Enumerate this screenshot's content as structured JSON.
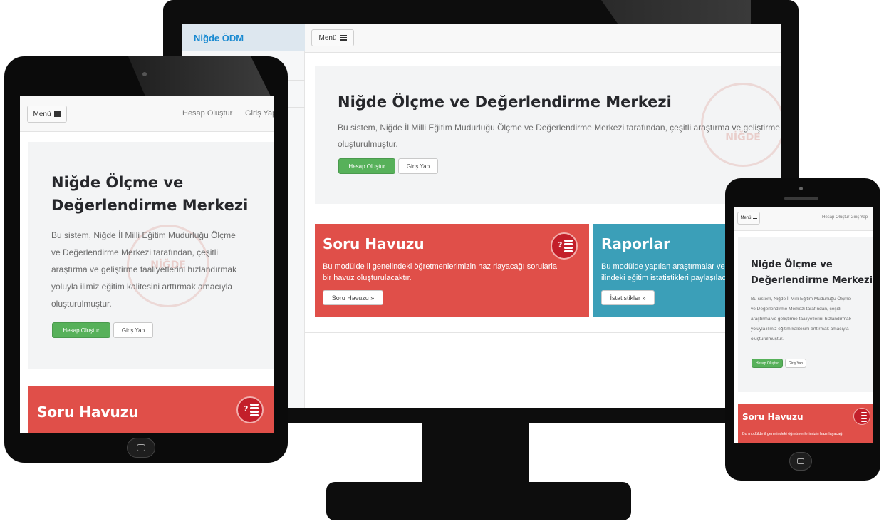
{
  "colors": {
    "brand_blue": "#1a8ad1",
    "green": "#57b15a",
    "red": "#e04f49",
    "teal": "#3b9fb8",
    "icon_red": "#c31f2a",
    "bezel": "#0d0d0d"
  },
  "desktop": {
    "brand": "Niğde ÖDM",
    "menu_label": "Menü",
    "title": "Niğde Ölçme ve Değerlendirme Merkezi",
    "lead_line1": "Bu sistem, Niğde İl Milli Eğitim Mudurluğu Ölçme ve Değerlendirme Merkezi tarafından, çeşitli araştırma ve geliştirme faaliyetlerini",
    "lead_line2": "oluşturulmuştur.",
    "btn_create": "Hesap Oluştur",
    "btn_login": "Giriş Yap",
    "seal_text": "NİĞDE",
    "card1": {
      "title": "Soru Havuzu",
      "text_line1": "Bu modülde il genelindeki öğretmenlerimizin hazırlayacağı sorularla",
      "text_line2": "bir havuz oluşturulacaktır.",
      "button": "Soru Havuzu »"
    },
    "card2": {
      "title": "Raporlar",
      "text_line1": "Bu modülde yapılan araştırmalar ve",
      "text_line2": "ilindeki eğitim istatistikleri paylaşılacaktır.",
      "button": "İstatistikler »"
    }
  },
  "tablet": {
    "menu_label": "Menü",
    "nav_create": "Hesap Oluştur",
    "nav_login": "Giriş Yap",
    "title_line1": "Niğde Ölçme ve",
    "title_line2": "Değerlendirme Merkezi",
    "lead_lines": [
      "Bu sistem, Niğde İl Milli Eğitim Mudurluğu Ölçme",
      "ve Değerlendirme Merkezi tarafından, çeşitli",
      "araştırma ve geliştirme faaliyetlerini hızlandırmak",
      "yoluyla ilimiz eğitim kalitesini arttırmak amacıyla",
      "oluşturulmuştur."
    ],
    "btn_create": "Hesap Oluştur",
    "btn_login": "Giriş Yap",
    "seal_text": "NİĞDE",
    "card_title": "Soru Havuzu"
  },
  "phone": {
    "menu_label": "Menü",
    "nav_create": "Hesap Oluştur",
    "nav_login": "Giriş Yap",
    "title_line1": "Niğde Ölçme ve",
    "title_line2": "Değerlendirme Merkezi",
    "lead_lines": [
      "Bu sistem, Niğde İl Milli Eğitim Mudurluğu Ölçme",
      "ve Değerlendirme Merkezi tarafından, çeşitli",
      "araştırma ve geliştirme faaliyetlerini hızlandırmak",
      "yoluyla ilimiz eğitim kalitesini arttırmak amacıyla",
      "oluşturulmuştur."
    ],
    "btn_create": "Hesap Oluştur",
    "btn_login": "Giriş Yap",
    "card_title": "Soru Havuzu",
    "card_text": "Bu modülde il genelindeki öğretmenlerimizin hazırlayacağı"
  }
}
